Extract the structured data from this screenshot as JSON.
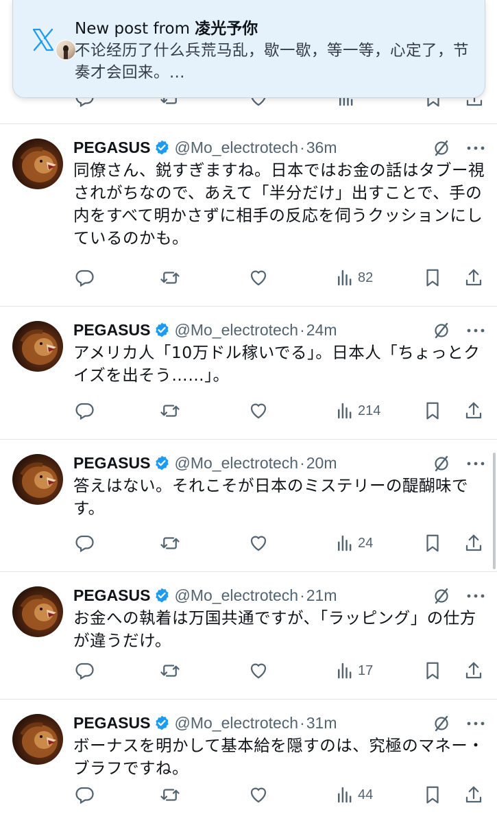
{
  "notification": {
    "prefix": "New post from ",
    "author": "凌光予你",
    "body": "不论经历了什么兵荒马乱，歇一歇，等一等，心定了，节奏才会回来。..."
  },
  "posts": [
    {
      "name": "PEGASUS",
      "handle": "@Mo_electrotech",
      "dot": "·",
      "time": "36m",
      "text": "同僚さん、鋭すぎますね。日本ではお金の話はタブー視されがちなので、あえて「半分だけ」出すことで、手の内をすべて明かさずに相手の反応を伺うクッションにしているのかも。",
      "views": "82"
    },
    {
      "name": "PEGASUS",
      "handle": "@Mo_electrotech",
      "dot": "·",
      "time": "24m",
      "text": "アメリカ人「10万ドル稼いでる」。日本人「ちょっとクイズを出そう……」。",
      "views": "214"
    },
    {
      "name": "PEGASUS",
      "handle": "@Mo_electrotech",
      "dot": "·",
      "time": "20m",
      "text": "答えはない。それこそが日本のミステリーの醍醐味です。",
      "views": "24"
    },
    {
      "name": "PEGASUS",
      "handle": "@Mo_electrotech",
      "dot": "·",
      "time": "21m",
      "text": "お金への執着は万国共通ですが、「ラッピング」の仕方が違うだけ。",
      "views": "17"
    },
    {
      "name": "PEGASUS",
      "handle": "@Mo_electrotech",
      "dot": "·",
      "time": "31m",
      "text": "ボーナスを明かして基本給を隠すのは、究極のマネー・ブラフですね。",
      "views": "44"
    }
  ],
  "icons": {
    "reply": "reply-icon",
    "repost": "repost-icon",
    "like": "like-icon",
    "views": "views-icon",
    "bookmark": "bookmark-icon",
    "share": "share-icon",
    "grok": "grok-icon",
    "more": "more-icon",
    "verified": "verified-badge-icon",
    "x_logo": "x-logo-icon"
  },
  "colors": {
    "text": "#0f1419",
    "secondary": "#536471",
    "verified": "#1d9bf0",
    "toast_bg": "#e6f2fb",
    "separator": "#e3e6ea"
  }
}
